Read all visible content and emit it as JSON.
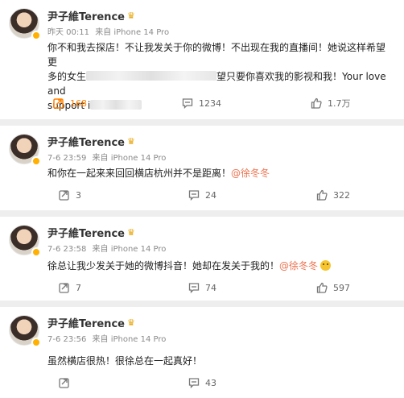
{
  "posts": [
    {
      "author": "尹子維Terence",
      "time": "昨天 00:11",
      "source": "来自 iPhone 14 Pro",
      "text_line1": "你不和我去探店！不让我发关于你的微博！不出现在我的直播间！她说这样希望更",
      "text_line2a": "多的女生",
      "text_line2b": "望只要你喜欢我的影视和我！Your love and",
      "text_line3": "support i",
      "reposts": "168",
      "comments": "1234",
      "likes": "1.7万"
    },
    {
      "author": "尹子維Terence",
      "time": "7-6 23:59",
      "source": "来自 iPhone 14 Pro",
      "text": "和你在一起来来回回横店杭州并不是距离！",
      "mention": "@徐冬冬",
      "reposts": "3",
      "comments": "24",
      "likes": "322"
    },
    {
      "author": "尹子維Terence",
      "time": "7-6 23:58",
      "source": "来自 iPhone 14 Pro",
      "text": "徐总让我少发关于她的微博抖音！她却在发关于我的！",
      "mention": "@徐冬冬",
      "reposts": "7",
      "comments": "74",
      "likes": "597"
    },
    {
      "author": "尹子維Terence",
      "time": "7-6 23:56",
      "source": "来自 iPhone 14 Pro",
      "text": "虽然横店很热！很徐总在一起真好！",
      "reposts": "",
      "comments": "43",
      "likes": ""
    }
  ],
  "icons": {
    "badge": "crown-icon",
    "repost": "repost-icon",
    "comment": "comment-icon",
    "like": "thumbs-up-icon"
  },
  "colors": {
    "accent": "#ff8200",
    "mention": "#eb7350",
    "meta": "#8a8a8a"
  }
}
